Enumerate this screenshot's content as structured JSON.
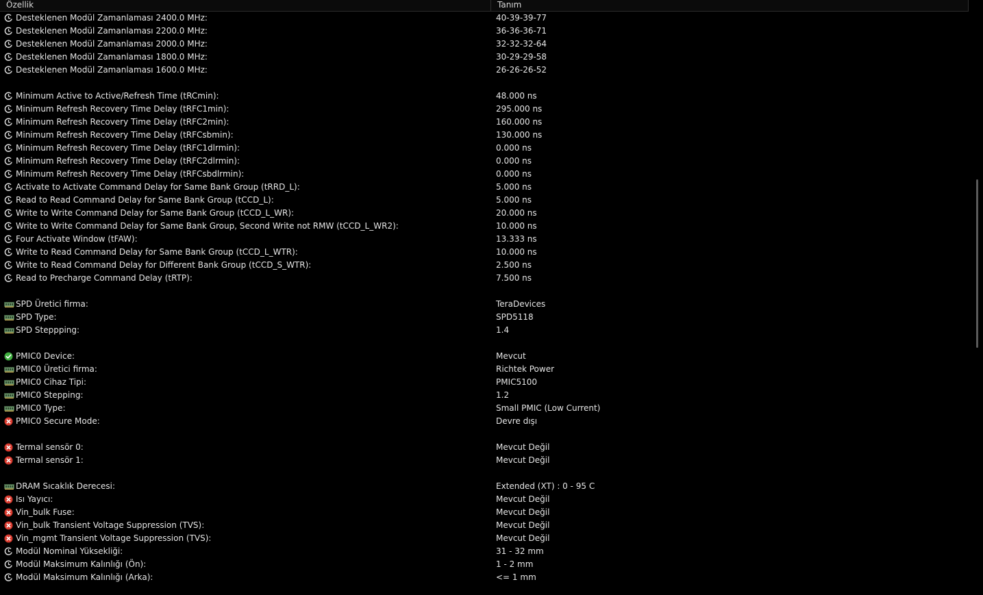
{
  "header": {
    "col1": "Özellik",
    "col2": "Tanım"
  },
  "rows": [
    {
      "icon": "clock-icon",
      "label": "Desteklenen Modül Zamanlaması 2400.0 MHz:",
      "value": "40-39-39-77"
    },
    {
      "icon": "clock-icon",
      "label": "Desteklenen Modül Zamanlaması 2200.0 MHz:",
      "value": "36-36-36-71"
    },
    {
      "icon": "clock-icon",
      "label": "Desteklenen Modül Zamanlaması 2000.0 MHz:",
      "value": "32-32-32-64"
    },
    {
      "icon": "clock-icon",
      "label": "Desteklenen Modül Zamanlaması 1800.0 MHz:",
      "value": "30-29-29-58"
    },
    {
      "icon": "clock-icon",
      "label": "Desteklenen Modül Zamanlaması 1600.0 MHz:",
      "value": "26-26-26-52"
    },
    {
      "icon": null,
      "label": "",
      "value": ""
    },
    {
      "icon": "clock-icon",
      "label": "Minimum Active to Active/Refresh Time (tRCmin):",
      "value": "48.000 ns"
    },
    {
      "icon": "clock-icon",
      "label": "Minimum Refresh Recovery Time Delay (tRFC1min):",
      "value": "295.000 ns"
    },
    {
      "icon": "clock-icon",
      "label": "Minimum Refresh Recovery Time Delay (tRFC2min):",
      "value": "160.000 ns"
    },
    {
      "icon": "clock-icon",
      "label": "Minimum Refresh Recovery Time Delay (tRFCsbmin):",
      "value": "130.000 ns"
    },
    {
      "icon": "clock-icon",
      "label": "Minimum Refresh Recovery Time Delay (tRFC1dlrmin):",
      "value": "0.000 ns"
    },
    {
      "icon": "clock-icon",
      "label": "Minimum Refresh Recovery Time Delay (tRFC2dlrmin):",
      "value": "0.000 ns"
    },
    {
      "icon": "clock-icon",
      "label": "Minimum Refresh Recovery Time Delay (tRFCsbdlrmin):",
      "value": "0.000 ns"
    },
    {
      "icon": "clock-icon",
      "label": "Activate to Activate Command Delay for Same Bank Group (tRRD_L):",
      "value": "5.000 ns"
    },
    {
      "icon": "clock-icon",
      "label": "Read to Read Command Delay for Same Bank Group (tCCD_L):",
      "value": "5.000 ns"
    },
    {
      "icon": "clock-icon",
      "label": "Write to Write Command Delay for Same Bank Group (tCCD_L_WR):",
      "value": "20.000 ns"
    },
    {
      "icon": "clock-icon",
      "label": "Write to Write Command Delay for Same Bank Group, Second Write not RMW (tCCD_L_WR2):",
      "value": "10.000 ns"
    },
    {
      "icon": "clock-icon",
      "label": "Four Activate Window (tFAW):",
      "value": "13.333 ns"
    },
    {
      "icon": "clock-icon",
      "label": "Write to Read Command Delay for Same Bank Group (tCCD_L_WTR):",
      "value": "10.000 ns"
    },
    {
      "icon": "clock-icon",
      "label": "Write to Read Command Delay for Different Bank Group (tCCD_S_WTR):",
      "value": "2.500 ns"
    },
    {
      "icon": "clock-icon",
      "label": "Read to Precharge Command Delay (tRTP):",
      "value": "7.500 ns"
    },
    {
      "icon": null,
      "label": "",
      "value": ""
    },
    {
      "icon": "memory-chip-icon",
      "label": "SPD Üretici firma:",
      "value": "TeraDevices"
    },
    {
      "icon": "memory-chip-icon",
      "label": "SPD Type:",
      "value": "SPD5118"
    },
    {
      "icon": "memory-chip-icon",
      "label": "SPD Steppping:",
      "value": "1.4"
    },
    {
      "icon": null,
      "label": "",
      "value": ""
    },
    {
      "icon": "check-icon",
      "label": "PMIC0 Device:",
      "value": "Mevcut"
    },
    {
      "icon": "memory-chip-icon",
      "label": "PMIC0 Üretici firma:",
      "value": "Richtek Power"
    },
    {
      "icon": "memory-chip-icon",
      "label": "PMIC0 Cihaz Tipi:",
      "value": "PMIC5100"
    },
    {
      "icon": "memory-chip-icon",
      "label": "PMIC0 Stepping:",
      "value": "1.2"
    },
    {
      "icon": "memory-chip-icon",
      "label": "PMIC0 Type:",
      "value": "Small PMIC (Low Current)"
    },
    {
      "icon": "error-icon",
      "label": "PMIC0 Secure Mode:",
      "value": "Devre dışı"
    },
    {
      "icon": null,
      "label": "",
      "value": ""
    },
    {
      "icon": "error-icon",
      "label": "Termal sensör 0:",
      "value": "Mevcut Değil"
    },
    {
      "icon": "error-icon",
      "label": "Termal sensör 1:",
      "value": "Mevcut Değil"
    },
    {
      "icon": null,
      "label": "",
      "value": ""
    },
    {
      "icon": "memory-chip-icon",
      "label": "DRAM Sıcaklık Derecesi:",
      "value": "Extended (XT) : 0 - 95 C"
    },
    {
      "icon": "error-icon",
      "label": "Isı Yayıcı:",
      "value": "Mevcut Değil"
    },
    {
      "icon": "error-icon",
      "label": "Vin_bulk Fuse:",
      "value": "Mevcut Değil"
    },
    {
      "icon": "error-icon",
      "label": "Vin_bulk Transient Voltage Suppression (TVS):",
      "value": "Mevcut Değil"
    },
    {
      "icon": "error-icon",
      "label": "Vin_mgmt Transient Voltage Suppression (TVS):",
      "value": "Mevcut Değil"
    },
    {
      "icon": "clock-icon",
      "label": "Modül Nominal Yüksekliği:",
      "value": "31 - 32 mm"
    },
    {
      "icon": "clock-icon",
      "label": "Modül Maksimum Kalınlığı (Ön):",
      "value": "1 - 2 mm"
    },
    {
      "icon": "clock-icon",
      "label": "Modül Maksimum Kalınlığı (Arka):",
      "value": "<= 1 mm"
    }
  ]
}
